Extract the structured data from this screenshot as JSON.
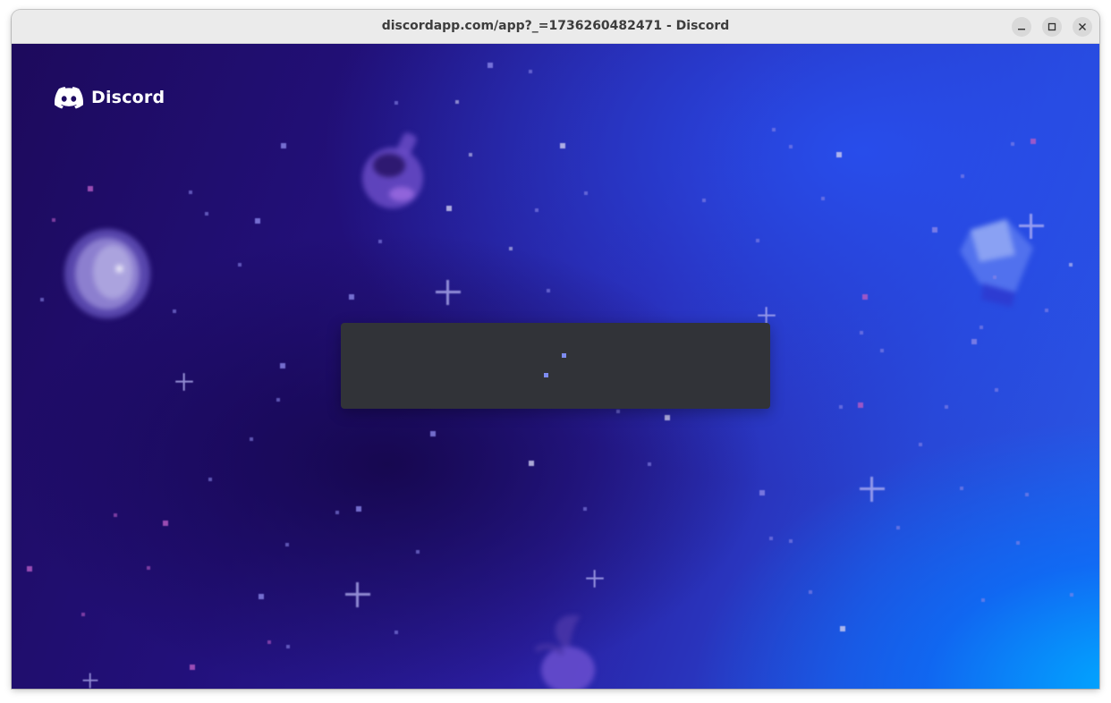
{
  "window": {
    "title": "discordapp.com/app?_=1736260482471 - Discord",
    "controls": {
      "minimize_icon": "minimize-icon",
      "maximize_icon": "maximize-icon",
      "close_icon": "close-icon"
    }
  },
  "app": {
    "logo_text": "Discord",
    "logo_icon": "discord-clyde-icon",
    "loading_state": "loading-spinner",
    "colors": {
      "background_start": "#1d0a5c",
      "background_end": "#00a8ff",
      "loader_panel": "#313338",
      "loader_dots": "#7e8cf0",
      "logo": "#ffffff"
    }
  }
}
